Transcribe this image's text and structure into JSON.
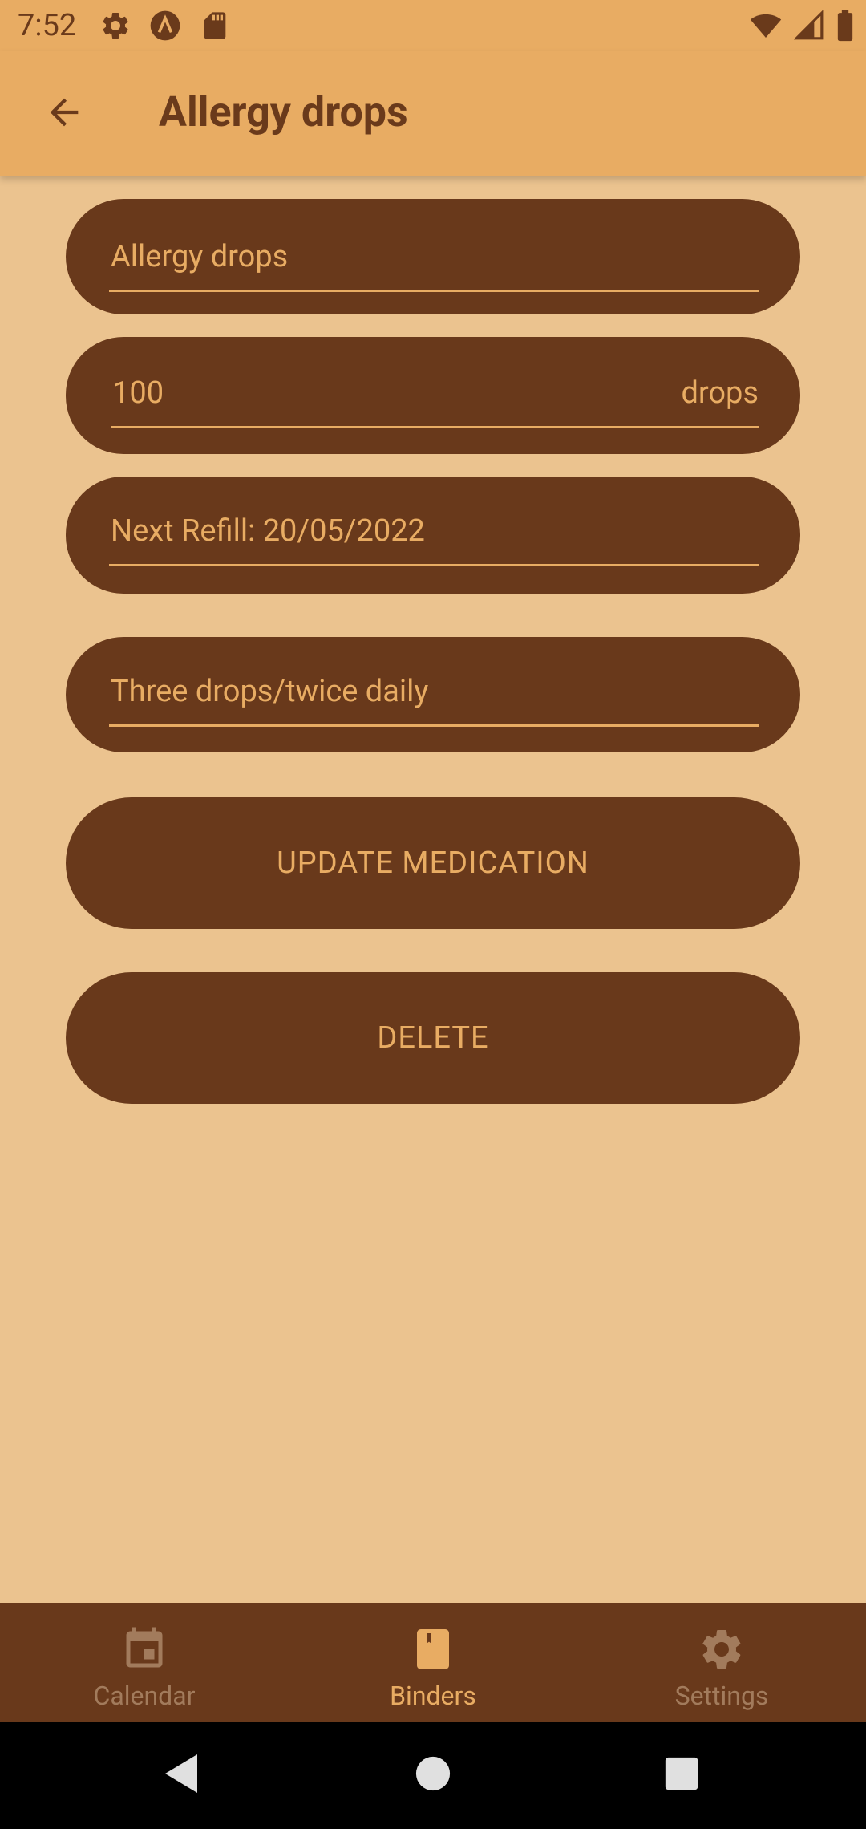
{
  "status_bar": {
    "time": "7:52",
    "left_icons": [
      "gear-icon",
      "a-circle-icon",
      "sd-card-icon"
    ],
    "right_icons": [
      "wifi-icon",
      "cell-signal-icon",
      "battery-icon"
    ]
  },
  "app_bar": {
    "back_icon": "arrow-back-icon",
    "title": "Allergy drops"
  },
  "form": {
    "name_value": "Allergy drops",
    "quantity_value": "100",
    "quantity_unit": "drops",
    "refill_value": "Next Refill: 20/05/2022",
    "dosage_value": "Three drops/twice daily"
  },
  "actions": {
    "update_label": "UPDATE MEDICATION",
    "delete_label": "DELETE"
  },
  "bottom_nav": {
    "items": [
      {
        "label": "Calendar",
        "icon": "calendar-icon",
        "active": false
      },
      {
        "label": "Binders",
        "icon": "book-icon",
        "active": true
      },
      {
        "label": "Settings",
        "icon": "settings-icon",
        "active": false
      }
    ]
  },
  "system_nav": [
    "back-triangle-icon",
    "home-circle-icon",
    "recents-square-icon"
  ],
  "colors": {
    "app_bar": "#E8AC63",
    "background": "#EBC38F",
    "pill": "#69391B",
    "pill_text": "#E8AC63",
    "nav_inactive": "#A27B5C",
    "nav_active": "#E8AC63"
  }
}
